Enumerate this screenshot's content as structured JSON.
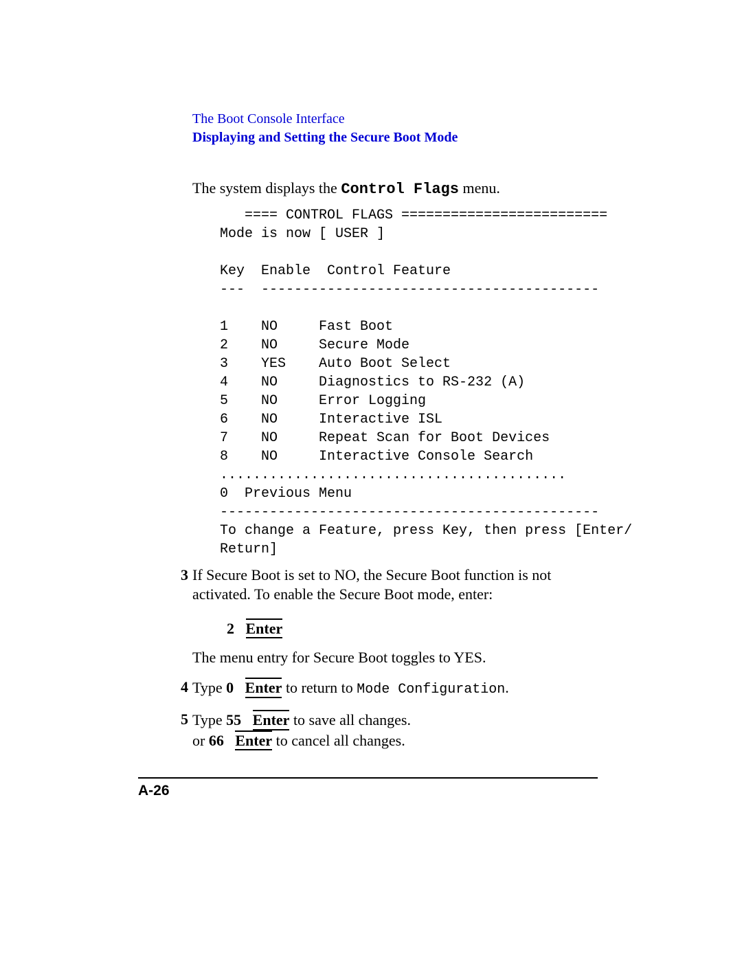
{
  "header": {
    "chapter": "The Boot Console Interface",
    "section": "Displaying and Setting the Secure Boot Mode"
  },
  "intro": {
    "pre": "The system displays the ",
    "code": "Control Flags",
    "post": " menu."
  },
  "console": "   ==== CONTROL FLAGS =========================\nMode is now [ USER ]\n\nKey  Enable  Control Feature\n---  -----------------------------------------\n\n1    NO     Fast Boot\n2    NO     Secure Mode\n3    YES    Auto Boot Select\n4    NO     Diagnostics to RS-232 (A)\n5    NO     Error Logging\n6    NO     Interactive ISL\n7    NO     Repeat Scan for Boot Devices\n8    NO     Interactive Console Search\n..........................................\n0  Previous Menu\n----------------------------------------------\nTo change a Feature, press Key, then press [Enter/\nReturn]",
  "steps": {
    "s3": {
      "num": "3",
      "text": "If Secure Boot is set to NO, the Secure Boot function is not activated. To enable the Secure Boot mode, enter:"
    },
    "s3_cmd_num": "2",
    "s3_cmd_key": "Enter",
    "s3_result": "The menu entry for Secure Boot toggles to YES.",
    "s4": {
      "num": "4",
      "pre": "Type ",
      "code_num": "0",
      "key": "Enter",
      "mid": " to return to ",
      "mono": "Mode Configuration",
      "end": "."
    },
    "s5": {
      "num": "5",
      "l1_pre": "Type ",
      "l1_code": "55",
      "l1_key": "Enter",
      "l1_post": " to save all changes.",
      "l2_pre": "or  ",
      "l2_code": "66",
      "l2_key": "Enter",
      "l2_post": " to cancel all changes."
    }
  },
  "footer": {
    "page": "A-26"
  }
}
